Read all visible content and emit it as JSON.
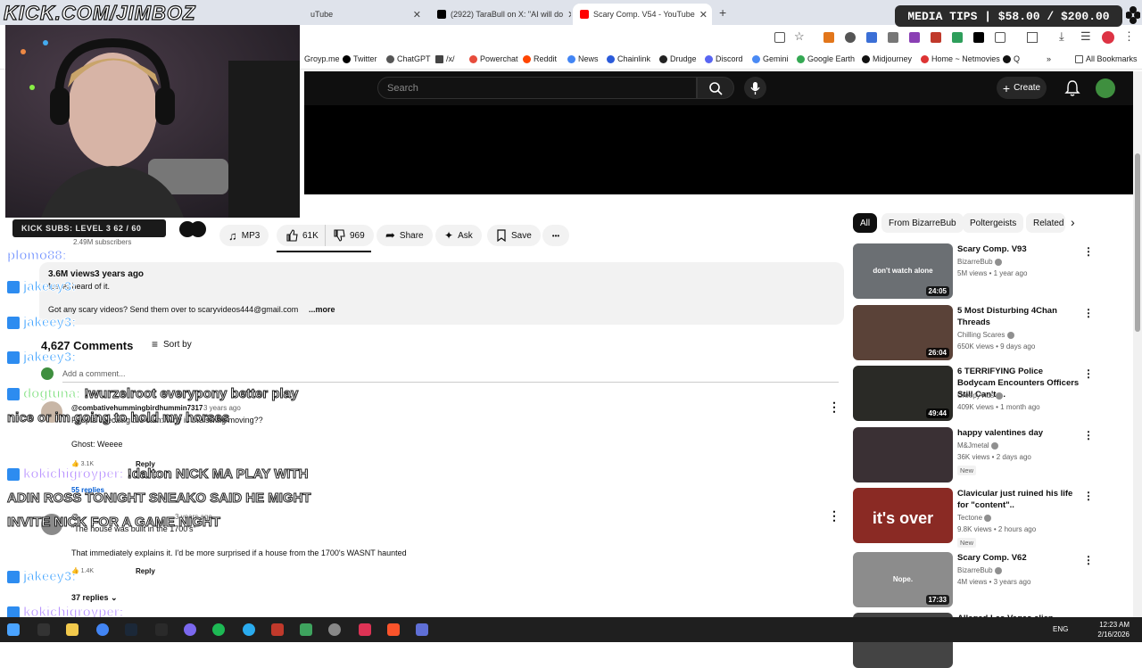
{
  "browser": {
    "tabs": [
      {
        "label": "uTube",
        "active": false
      },
      {
        "label": "(2922) TaraBull on X: \"AI will do",
        "active": false
      },
      {
        "label": "Scary Comp. V54 - YouTube",
        "active": true
      }
    ],
    "new_tab": "+",
    "bookmarks": [
      "Groyp.me",
      "Twitter",
      "ChatGPT",
      "/x/",
      "Powerchat",
      "Reddit",
      "News",
      "Chainlink",
      "Drudge",
      "Discord",
      "Gemini",
      "Google Earth",
      "Midjourney",
      "Home ~ Netmovies",
      "Q"
    ],
    "all_bookmarks": "All Bookmarks",
    "more": "»"
  },
  "youtube": {
    "search_placeholder": "Search",
    "create_label": "Create",
    "channel_subscribers": "2.49M subscribers",
    "actions": {
      "mp3": "MP3",
      "likes": "61K",
      "dislikes": "969",
      "share": "Share",
      "ask": "Ask",
      "save": "Save",
      "more": "•••"
    },
    "description": {
      "views": "3.6M views",
      "age": "3 years ago",
      "line2": "Never heard of it.",
      "text": "Got any scary videos? Send them over to scaryvideos444@gmail.com",
      "more": "...more"
    },
    "comments": {
      "count": "4,627 Comments",
      "sort": "Sort by",
      "add": "Add a comment...",
      "items": [
        {
          "author": "@combativehummingbirdhummin7317",
          "age": "3 years ago",
          "line1": "People checking the cam: Why is the swing moving??",
          "line2": "Ghost: Weeee",
          "likes": "3.1K",
          "reply": "Reply",
          "replies": "55 replies"
        },
        {
          "author": "@",
          "age": "3 years ago",
          "line1": "\"The house was built in the 1700's\"",
          "line2": "That immediately explains it. I'd be more surprised if a house from the 1700's WASNT haunted",
          "likes": "1.4K",
          "reply": "Reply",
          "replies": "37 replies"
        }
      ]
    },
    "chips": [
      "All",
      "From BizarreBub",
      "Poltergeists",
      "Related"
    ],
    "recommendations": [
      {
        "title": "Scary Comp. V93",
        "channel": "BizarreBub",
        "stats": "5M views • 1 year ago",
        "duration": "24:05",
        "badge": "",
        "thumb_text": "don't watch alone",
        "color": "#6b6f73"
      },
      {
        "title": "5 Most Disturbing 4Chan Threads",
        "channel": "Chilling Scares",
        "stats": "650K views • 9 days ago",
        "duration": "26:04",
        "badge": "",
        "thumb_text": "",
        "color": "#5a4238"
      },
      {
        "title": "6 TERRIFYING Police Bodycam Encounters Officers Still Can't ...",
        "channel": "CreepyVids",
        "stats": "409K views • 1 month ago",
        "duration": "49:44",
        "badge": "",
        "thumb_text": "",
        "color": "#2a2a26"
      },
      {
        "title": "happy valentines day",
        "channel": "M&Jmetal",
        "stats": "36K views • 2 days ago",
        "duration": "",
        "badge": "New",
        "thumb_text": "",
        "color": "#3a3034"
      },
      {
        "title": "Clavicular just ruined his life for \"content\"..",
        "channel": "Tectone",
        "stats": "9.8K views • 2 hours ago",
        "duration": "",
        "badge": "New",
        "thumb_text": "it's over",
        "color": "#8a2a24"
      },
      {
        "title": "Scary Comp. V62",
        "channel": "BizarreBub",
        "stats": "4M views • 3 years ago",
        "duration": "17:33",
        "badge": "",
        "thumb_text": "Nope.",
        "color": "#8c8c8c"
      },
      {
        "title": "Alleged Las Vegas alien",
        "channel": "",
        "stats": "",
        "duration": "",
        "badge": "",
        "thumb_text": "",
        "color": "#444444"
      }
    ]
  },
  "stream_overlay": {
    "url": "KICK.COM/JIMBOZ",
    "kick_subs": "KICK SUBS: LEVEL 3 62 / 60",
    "media_tips": "MEDIA TIPS | $58.00 / $200.00",
    "chat": [
      {
        "user": "plomo88:",
        "msg": ""
      },
      {
        "user": "jakeey3:",
        "msg": ""
      },
      {
        "user": "jakeey3:",
        "msg": ""
      },
      {
        "user": "jakeey3:",
        "msg": ""
      },
      {
        "user": "dogtuna:",
        "msg": "!wurzelroot everypony better play nice or im going to hold my horses"
      },
      {
        "user": "kokichigroyper:",
        "msg": "!dalton NICK MA PLAY WITH ADIN ROSS TONIGHT SNEAKO SAID HE MIGHT INVITE NICK FOR A GAME NIGHT"
      },
      {
        "user": "jakeey3:",
        "msg": ""
      },
      {
        "user": "kokichigroyper:",
        "msg": ""
      }
    ]
  },
  "taskbar": {
    "time": "12:23 AM",
    "date": "2/16/2026",
    "lang": "ENG"
  }
}
